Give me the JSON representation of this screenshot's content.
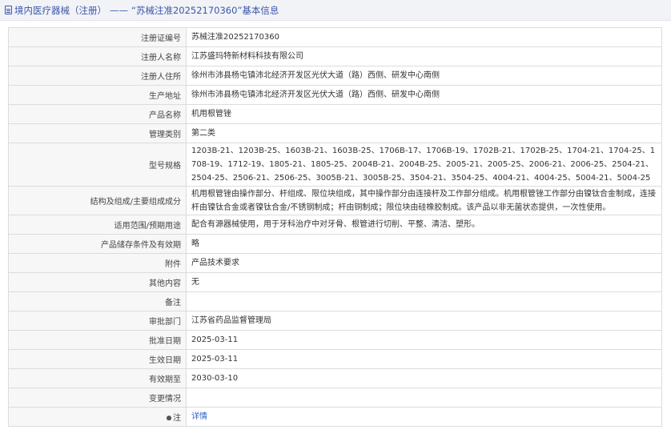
{
  "breadcrumb": {
    "category": "境内医疗器械（注册）",
    "separator": "——",
    "record": "“苏械注准20252170360”基本信息"
  },
  "fields": {
    "reg_no": {
      "label": "注册证编号",
      "value": "苏械注准20252170360"
    },
    "registrant": {
      "label": "注册人名称",
      "value": "江苏盛玛特新材料科技有限公司"
    },
    "address": {
      "label": "注册人住所",
      "value": "徐州市沛县杨屯镇沛北经济开发区光伏大道（路）西侧、研发中心南侧"
    },
    "prod_address": {
      "label": "生产地址",
      "value": "徐州市沛县杨屯镇沛北经济开发区光伏大道（路）西侧、研发中心南侧"
    },
    "product_name": {
      "label": "产品名称",
      "value": "机用根管锉"
    },
    "category": {
      "label": "管理类别",
      "value": "第二类"
    },
    "models": {
      "label": "型号规格",
      "value": "1203B-21、1203B-25、1603B-21、1603B-25、1706B-17、1706B-19、1702B-21、1702B-25、1704-21、1704-25、1708-19、1712-19、1805-21、1805-25、2004B-21、2004B-25、2005-21、2005-25、2006-21、2006-25、2504-21、2504-25、2506-21、2506-25、3005B-21、3005B-25、3504-21、3504-25、4004-21、4004-25、5004-21、5004-25"
    },
    "structure": {
      "label": "结构及组成/主要组成成分",
      "value": "机用根管锉由操作部分、杆组成、限位块组成，其中操作部分由连接杆及工作部分组成。机用根管锉工作部分由镍钛合金制成，连接杆由镍钛合金或者镍钛合金/不锈钢制成；杆由铜制成；限位块由硅橡胶制成。该产品以非无菌状态提供，一次性使用。"
    },
    "usage": {
      "label": "适用范围/预期用途",
      "value": "配合有源器械使用，用于牙科治疗中对牙骨、根管进行切削、平整、清洁、塑形。"
    },
    "storage": {
      "label": "产品储存条件及有效期",
      "value": "略"
    },
    "attachment": {
      "label": "附件",
      "value": "产品技术要求"
    },
    "other": {
      "label": "其他内容",
      "value": "无"
    },
    "remark": {
      "label": "备注",
      "value": ""
    },
    "approver": {
      "label": "审批部门",
      "value": "江苏省药品监督管理局"
    },
    "approval_date": {
      "label": "批准日期",
      "value": "2025-03-11"
    },
    "effective_date": {
      "label": "生效日期",
      "value": "2025-03-11"
    },
    "expiry_date": {
      "label": "有效期至",
      "value": "2030-03-10"
    },
    "changes": {
      "label": "变更情况",
      "value": ""
    },
    "note": {
      "label": "注",
      "value": "详情"
    }
  }
}
